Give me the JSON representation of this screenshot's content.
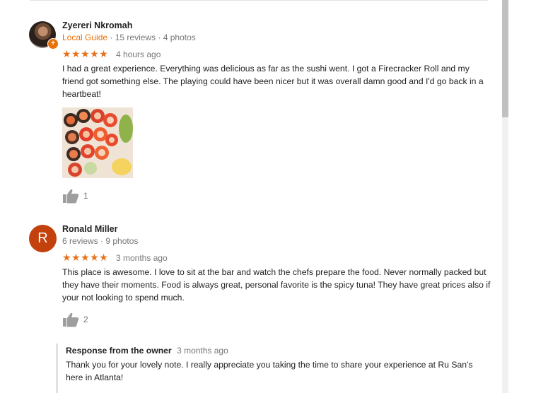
{
  "reviews": [
    {
      "name": "Zyereri Nkromah",
      "local_guide": "Local Guide",
      "stats": "· 15 reviews · 4 photos",
      "stars": "★★★★★",
      "time": "4 hours ago",
      "text": "I had a great experience. Everything was delicious as far as the sushi went. I got a Firecracker Roll and my friend got something else. The playing could have been nicer but it was overall damn good and I'd go back in a heartbeat!",
      "likes": "1"
    },
    {
      "name": "Ronald Miller",
      "avatar_letter": "R",
      "stats": "6 reviews · 9 photos",
      "stars": "★★★★★",
      "time": "3 months ago",
      "text": "This place is awesome. I love to sit at the bar and watch the chefs prepare the food. Never normally packed but they have their moments. Food is always great, personal favorite is the spicy tuna! They have great prices also if your not looking to spend much.",
      "likes": "2"
    }
  ],
  "owner_response": {
    "title": "Response from the owner",
    "time": "3 months ago",
    "text": "Thank you for your lovely note. I really appreciate you taking the time to share your experience at Ru San's here in Atlanta!"
  },
  "colors": {
    "star": "#e7711b",
    "local_guide": "#e8710a",
    "avatar_r": "#c2410c",
    "muted_text": "#777777"
  },
  "icons": [
    "local-guide-badge-icon",
    "thumbs-up-icon"
  ]
}
